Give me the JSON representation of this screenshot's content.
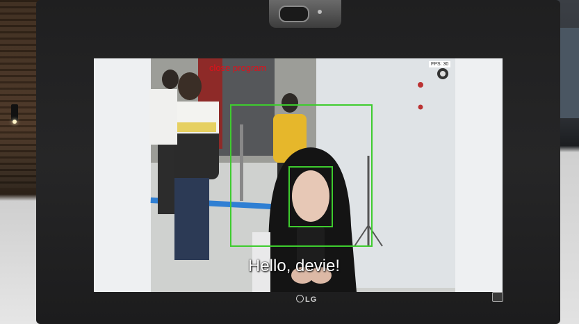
{
  "screen": {
    "overlay_top_text": "close program",
    "fps_label": "FPS: 30",
    "greeting": "Hello, devie!",
    "detection_color": "#3ecc2e",
    "overlay_text_color": "#e0101a"
  },
  "monitor": {
    "brand": "LG",
    "icons": [
      "webcam-icon",
      "power-icon"
    ]
  }
}
